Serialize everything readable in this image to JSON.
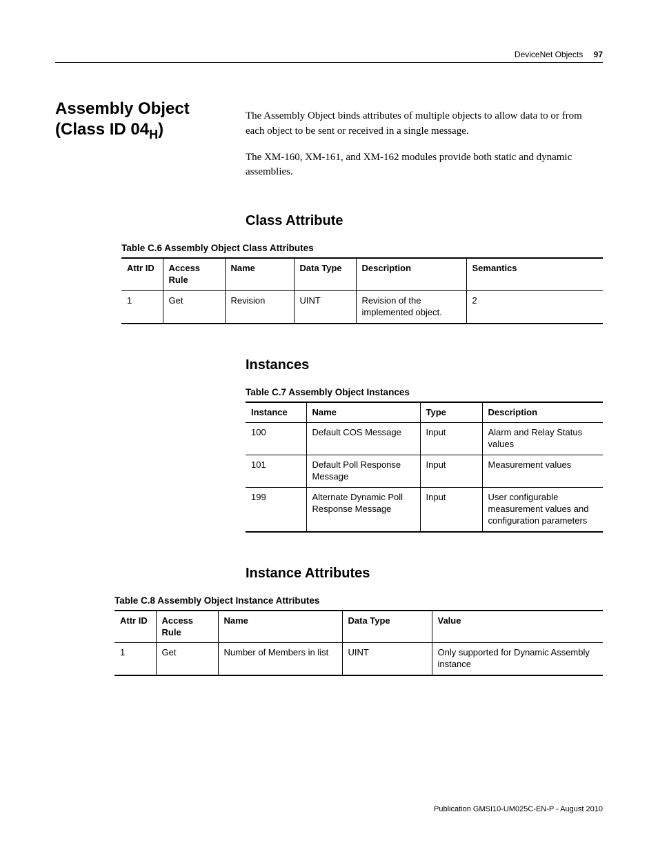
{
  "header": {
    "section": "DeviceNet Objects",
    "page_number": "97"
  },
  "title": {
    "line1": "Assembly Object",
    "line2_prefix": "(Class ID 04",
    "line2_sub": "H",
    "line2_suffix": ")"
  },
  "intro": {
    "p1": "The Assembly Object binds attributes of multiple objects to allow data to or from each object to be sent or received in a single message.",
    "p2": "The XM-160, XM-161, and XM-162 modules provide both static and dynamic assemblies."
  },
  "sections": {
    "class_attribute": {
      "heading": "Class Attribute"
    },
    "instances": {
      "heading": "Instances"
    },
    "instance_attributes": {
      "heading": "Instance Attributes"
    }
  },
  "table_c6": {
    "caption": "Table C.6 Assembly Object Class Attributes",
    "headers": {
      "c1": "Attr ID",
      "c2": "Access Rule",
      "c3": "Name",
      "c4": "Data Type",
      "c5": "Description",
      "c6": "Semantics"
    },
    "rows": [
      {
        "c1": "1",
        "c2": "Get",
        "c3": "Revision",
        "c4": "UINT",
        "c5": "Revision of the implemented object.",
        "c6": "2"
      }
    ]
  },
  "table_c7": {
    "caption": "Table C.7 Assembly Object Instances",
    "headers": {
      "c1": "Instance",
      "c2": "Name",
      "c3": "Type",
      "c4": "Description"
    },
    "rows": [
      {
        "c1": "100",
        "c2": "Default COS Message",
        "c3": "Input",
        "c4": "Alarm and Relay Status values"
      },
      {
        "c1": "101",
        "c2": "Default Poll Response Message",
        "c3": "Input",
        "c4": "Measurement values"
      },
      {
        "c1": "199",
        "c2": "Alternate Dynamic Poll Response Message",
        "c3": "Input",
        "c4": "User configurable measurement values and configuration parameters"
      }
    ]
  },
  "table_c8": {
    "caption": "Table C.8 Assembly Object Instance Attributes",
    "headers": {
      "c1": "Attr ID",
      "c2": "Access Rule",
      "c3": "Name",
      "c4": "Data Type",
      "c5": "Value"
    },
    "rows": [
      {
        "c1": "1",
        "c2": "Get",
        "c3": "Number of Members in list",
        "c4": "UINT",
        "c5": "Only supported for Dynamic Assembly instance"
      }
    ]
  },
  "footer": {
    "publication": "Publication GMSI10-UM025C-EN-P - August 2010"
  }
}
